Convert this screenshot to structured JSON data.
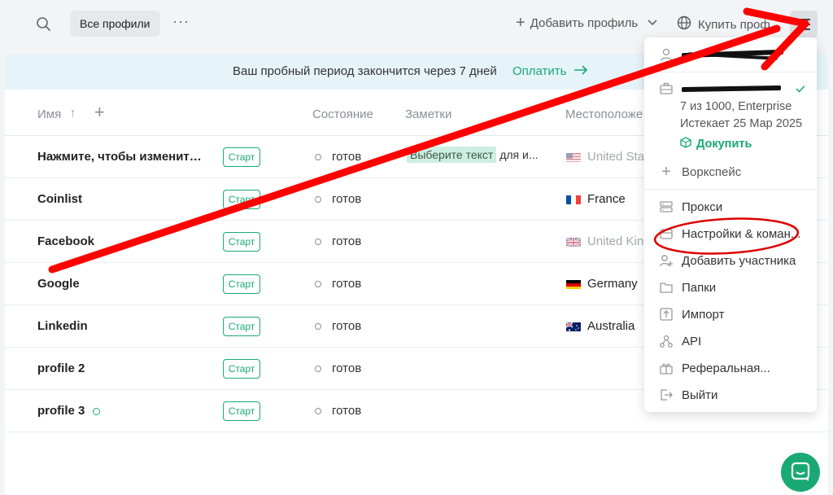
{
  "topbar": {
    "profiles_filter": "Все профили",
    "add_profile_label": "Добавить профиль",
    "buy_profiles_label": "Купить проф"
  },
  "banner": {
    "text": "Ваш пробный период закончится через 7 дней",
    "pay_label": "Оплатить"
  },
  "table": {
    "headers": {
      "name": "Имя",
      "sort_arrow": "↑",
      "add_column": "+",
      "status": "Состояние",
      "notes": "Заметки",
      "location": "Местоположе"
    },
    "rows": [
      {
        "name": "Нажмите, чтобы изменить и...",
        "start": "Старт",
        "status": "готов",
        "note_highlight": "Выберите текст",
        "note_rest": "для и...",
        "location": "United Stat",
        "flag": "us",
        "faded": true
      },
      {
        "name": "Coinlist",
        "start": "Старт",
        "status": "готов",
        "note_highlight": "",
        "note_rest": "",
        "location": "France",
        "flag": "fr",
        "faded": false
      },
      {
        "name": "Facebook",
        "start": "Старт",
        "status": "готов",
        "note_highlight": "",
        "note_rest": "",
        "location": "United King",
        "flag": "gb",
        "faded": true
      },
      {
        "name": "Google",
        "start": "Старт",
        "status": "готов",
        "note_highlight": "",
        "note_rest": "",
        "location": "Germany",
        "flag": "de",
        "faded": false
      },
      {
        "name": "Linkedin",
        "start": "Старт",
        "status": "готов",
        "note_highlight": "",
        "note_rest": "",
        "location": "Australia",
        "flag": "au",
        "faded": false
      },
      {
        "name": "profile 2",
        "start": "Старт",
        "status": "готов",
        "note_highlight": "",
        "note_rest": "",
        "location": "",
        "flag": "",
        "faded": false
      },
      {
        "name": "profile 3",
        "start": "Старт",
        "status": "готов",
        "note_highlight": "",
        "note_rest": "",
        "location": "",
        "flag": "",
        "faded": false,
        "online": true
      }
    ]
  },
  "menu": {
    "plan_usage": "7 из 1000, Enterprise",
    "plan_expires": "Истекает 25 Мар 2025",
    "buy_more": "Докупить",
    "add_workspace": "Воркспейс",
    "items": [
      {
        "label": "Прокси",
        "icon": "proxy-icon"
      },
      {
        "label": "Настройки & коман...",
        "icon": "settings-icon"
      },
      {
        "label": "Добавить участника",
        "icon": "add-user-icon"
      },
      {
        "label": "Папки",
        "icon": "folder-icon"
      },
      {
        "label": "Импорт",
        "icon": "import-icon"
      },
      {
        "label": "API",
        "icon": "api-icon"
      },
      {
        "label": "Реферальная...",
        "icon": "gift-icon"
      },
      {
        "label": "Выйти",
        "icon": "logout-icon"
      }
    ]
  },
  "colors": {
    "accent": "#19a974",
    "annotation": "#ff0000",
    "banner_bg": "#e6f3f9"
  }
}
